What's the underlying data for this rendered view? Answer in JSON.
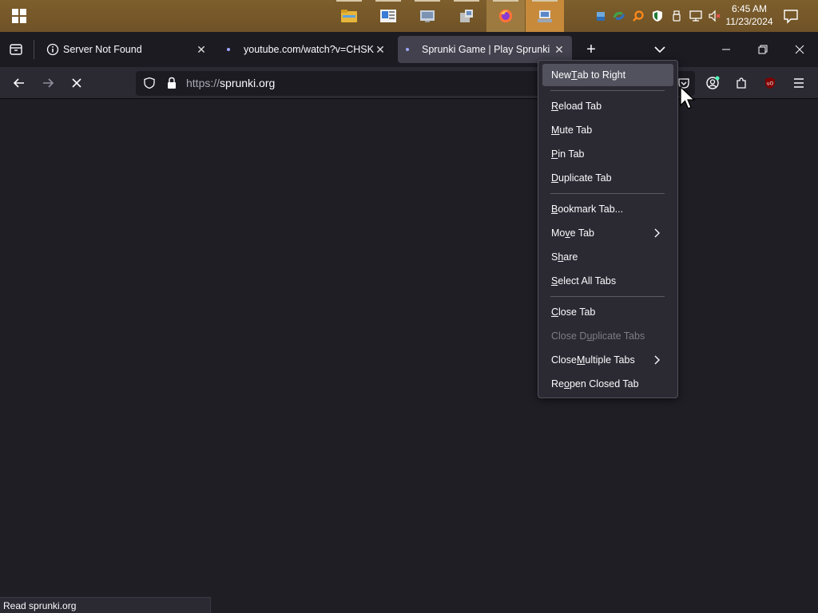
{
  "taskbar": {
    "start_icon": "windows-logo",
    "apps": [
      {
        "name": "file-explorer",
        "color": "#e7b53b"
      },
      {
        "name": "news-app",
        "color": "#3a7bd5"
      },
      {
        "name": "control-panel",
        "color": "#9aa6b8"
      },
      {
        "name": "device-manager",
        "color": "#b8b8b8"
      },
      {
        "name": "firefox",
        "color": "#ff7139"
      },
      {
        "name": "network-tool",
        "color": "#5a87c7"
      }
    ],
    "clock_time": "6:45 AM",
    "clock_date": "11/23/2024"
  },
  "tabs": [
    {
      "title": "Server Not Found",
      "icon": "info-icon"
    },
    {
      "title": "youtube.com/watch?v=CHSKvB",
      "icon": "dot-icon"
    },
    {
      "title": "Sprunki Game | Play Sprunki Inc",
      "icon": "dot-icon"
    }
  ],
  "url": {
    "scheme": "https://",
    "host": "sprunki.org"
  },
  "status_text": "Read sprunki.org",
  "menu": {
    "new_tab_right": {
      "pre": "New ",
      "key": "T",
      "post": "ab to Right"
    },
    "reload": {
      "pre": "",
      "key": "R",
      "post": "eload Tab"
    },
    "mute": {
      "pre": "",
      "key": "M",
      "post": "ute Tab"
    },
    "pin": {
      "pre": "",
      "key": "P",
      "post": "in Tab"
    },
    "duplicate": {
      "pre": "",
      "key": "D",
      "post": "uplicate Tab"
    },
    "bookmark": {
      "pre": "",
      "key": "B",
      "post": "ookmark Tab..."
    },
    "move": {
      "pre": "Mo",
      "key": "v",
      "post": "e Tab"
    },
    "share": {
      "pre": "S",
      "key": "h",
      "post": "are"
    },
    "select_all": {
      "pre": "",
      "key": "S",
      "post": "elect All Tabs"
    },
    "close": {
      "pre": "",
      "key": "C",
      "post": "lose Tab"
    },
    "close_dup": {
      "pre": "Close D",
      "key": "u",
      "post": "plicate Tabs"
    },
    "close_multi": {
      "pre": "Close ",
      "key": "M",
      "post": "ultiple Tabs"
    },
    "reopen": {
      "pre": "Re",
      "key": "o",
      "post": "pen Closed Tab"
    }
  }
}
